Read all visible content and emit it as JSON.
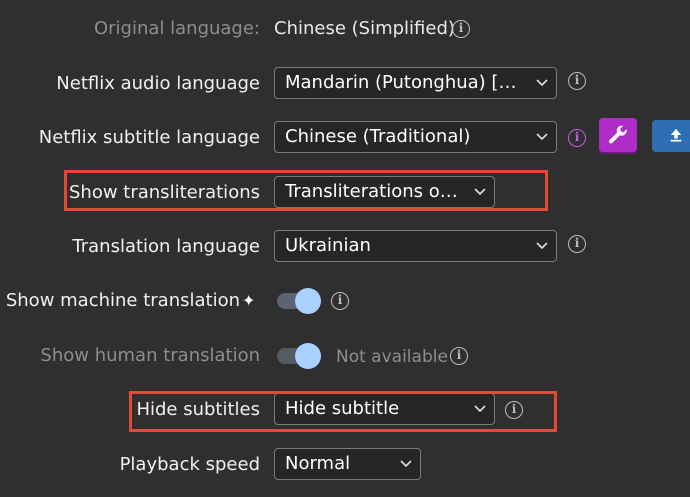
{
  "settings": {
    "original_language": {
      "label": "Original language:",
      "value": "Chinese (Simplified)"
    },
    "audio_language": {
      "label": "Netflix audio language",
      "value": "Mandarin (Putonghua) [Original]",
      "display": "Mandarin (Putonghua) [Ori…"
    },
    "subtitle_language": {
      "label": "Netflix subtitle language",
      "value": "Chinese (Traditional)"
    },
    "transliterations": {
      "label": "Show transliterations",
      "value": "Transliterations only"
    },
    "translation_language": {
      "label": "Translation language",
      "value": "Ukrainian"
    },
    "machine_translation": {
      "label": "Show machine translation",
      "sparkle": "✦",
      "on": true
    },
    "human_translation": {
      "label": "Show human translation",
      "on": true,
      "status": "Not available"
    },
    "hide_subtitles": {
      "label": "Hide subtitles",
      "value": "Hide subtitle"
    },
    "playback_speed": {
      "label": "Playback speed",
      "value": "Normal"
    }
  },
  "icons": {
    "info": "info-icon",
    "wrench": "wrench-icon",
    "upload": "upload-icon",
    "sparkle": "sparkle-icon"
  },
  "colors": {
    "background": "#2f2f2f",
    "highlight": "#e34a35",
    "toggle_knob": "#a9d0ff",
    "wrench_button": "#b02cc8",
    "upload_button": "#2d6fb2",
    "info_purple": "#c25ee0"
  }
}
